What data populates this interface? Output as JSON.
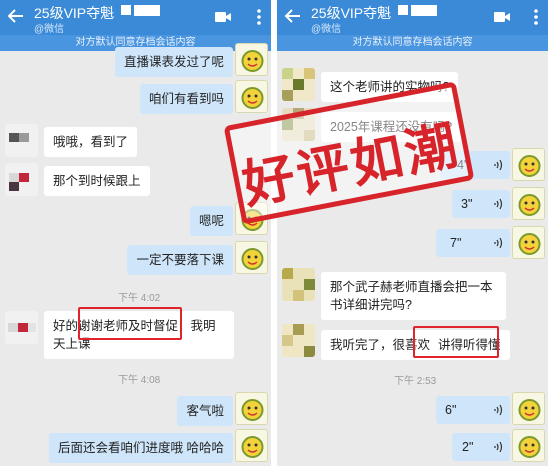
{
  "left": {
    "header": {
      "title": "25级VIP夺魁",
      "subtitle": "@微信"
    },
    "notice": "对方默认同意存档会话内容",
    "messages": [
      {
        "text": "直播课表发过了呢"
      },
      {
        "text": "咱们有看到吗"
      },
      {
        "text": "哦哦，看到了"
      },
      {
        "text": "那个到时候跟上"
      },
      {
        "text": "嗯呢"
      },
      {
        "text": "一定不要落下课"
      },
      {
        "text_start": "好的",
        "text_highlight": "谢谢老师及时督促",
        "text_end": "，我明天上课"
      },
      {
        "text": "客气啦"
      },
      {
        "text": "后面还会看咱们进度哦 哈哈哈"
      }
    ],
    "times": [
      "下午 4:02",
      "下午 4:08"
    ]
  },
  "right": {
    "header": {
      "title": "25级VIP夺魁",
      "subtitle": "@微信"
    },
    "notice": "对方默认同意存档会话内容",
    "messages": [
      {
        "text": "这个老师讲的实物吗?"
      },
      {
        "text": "2025年课程还没有吗?"
      },
      {
        "duration": "4\""
      },
      {
        "duration": "3\""
      },
      {
        "duration": "7\""
      },
      {
        "text": "那个武子赫老师直播会把一本书详细讲完吗?"
      },
      {
        "text_start": "我听完了，很喜欢",
        "text_highlight": "讲得听得懂"
      },
      {
        "duration": "6\""
      },
      {
        "duration": "2\""
      }
    ],
    "times": [
      "下午 2:53"
    ]
  },
  "stamp": "好评如潮",
  "colors": {
    "header_bg": "#3a8ad8",
    "chat_bg": "#eaeaea",
    "sent_bubble": "#cfe6fa",
    "highlight_red": "#e0242a"
  }
}
